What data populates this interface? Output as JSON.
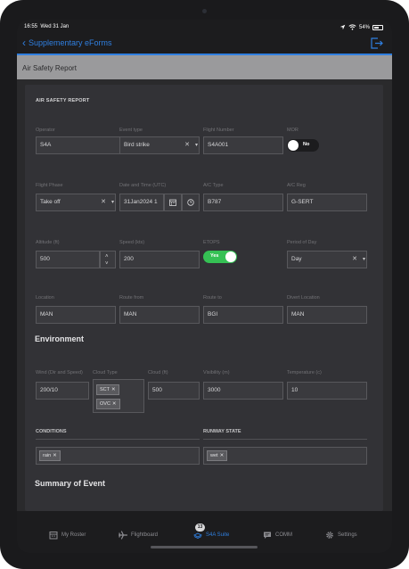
{
  "status": {
    "time": "16:55",
    "date": "Wed 31 Jan",
    "battery": "54%"
  },
  "nav": {
    "back_label": "Supplementary eForms"
  },
  "sheet": {
    "title": "Air Safety Report"
  },
  "form": {
    "section_title": "AIR SAFETY REPORT",
    "operator": {
      "label": "Operator",
      "value": "S4A"
    },
    "event_type": {
      "label": "Event type",
      "value": "Bird strike"
    },
    "flight_number": {
      "label": "Flight Number",
      "value": "S4A001"
    },
    "mor": {
      "label": "MOR",
      "value": "No"
    },
    "flight_phase": {
      "label": "Flight Phase",
      "value": "Take off"
    },
    "date_time": {
      "label": "Date and Time (UTC)",
      "value": "31Jan2024 1"
    },
    "ac_type": {
      "label": "A/C Type",
      "value": "B787"
    },
    "ac_reg": {
      "label": "A/C Reg",
      "value": "G-SERT"
    },
    "altitude": {
      "label": "Altitude (ft)",
      "value": "500"
    },
    "speed": {
      "label": "Speed (kts)",
      "value": "200"
    },
    "etops": {
      "label": "ETOPS",
      "value": "Yes"
    },
    "period_of_day": {
      "label": "Period of Day",
      "value": "Day"
    },
    "location": {
      "label": "Location",
      "value": "MAN"
    },
    "route_from": {
      "label": "Route from",
      "value": "MAN"
    },
    "route_to": {
      "label": "Route to",
      "value": "BGI"
    },
    "divert_location": {
      "label": "Divert Location",
      "value": "MAN"
    },
    "environment_heading": "Environment",
    "wind": {
      "label": "Wind (Dir and Speed)",
      "value": "200/10"
    },
    "cloud_type": {
      "label": "Cloud Type",
      "chips": [
        "SCT",
        "OVC"
      ]
    },
    "cloud_ft": {
      "label": "Cloud (ft)",
      "value": "500"
    },
    "visibility": {
      "label": "Visibility (m)",
      "value": "3000"
    },
    "temperature": {
      "label": "Temperature (c)",
      "value": "10"
    },
    "conditions": {
      "label": "CONDITIONS",
      "chips": [
        "rain"
      ]
    },
    "runway_state": {
      "label": "RUNWAY STATE",
      "chips": [
        "wet"
      ]
    },
    "summary_heading": "Summary of Event"
  },
  "tabs": {
    "my_roster": "My Roster",
    "flightboard": "Flightboard",
    "s4a_suite": "S4A Suite",
    "s4a_suite_badge": "13",
    "comm": "COMM",
    "settings": "Settings"
  },
  "colors": {
    "accent": "#2f7fe0",
    "toggle_on": "#35c154",
    "background": "#2a2a2c"
  }
}
